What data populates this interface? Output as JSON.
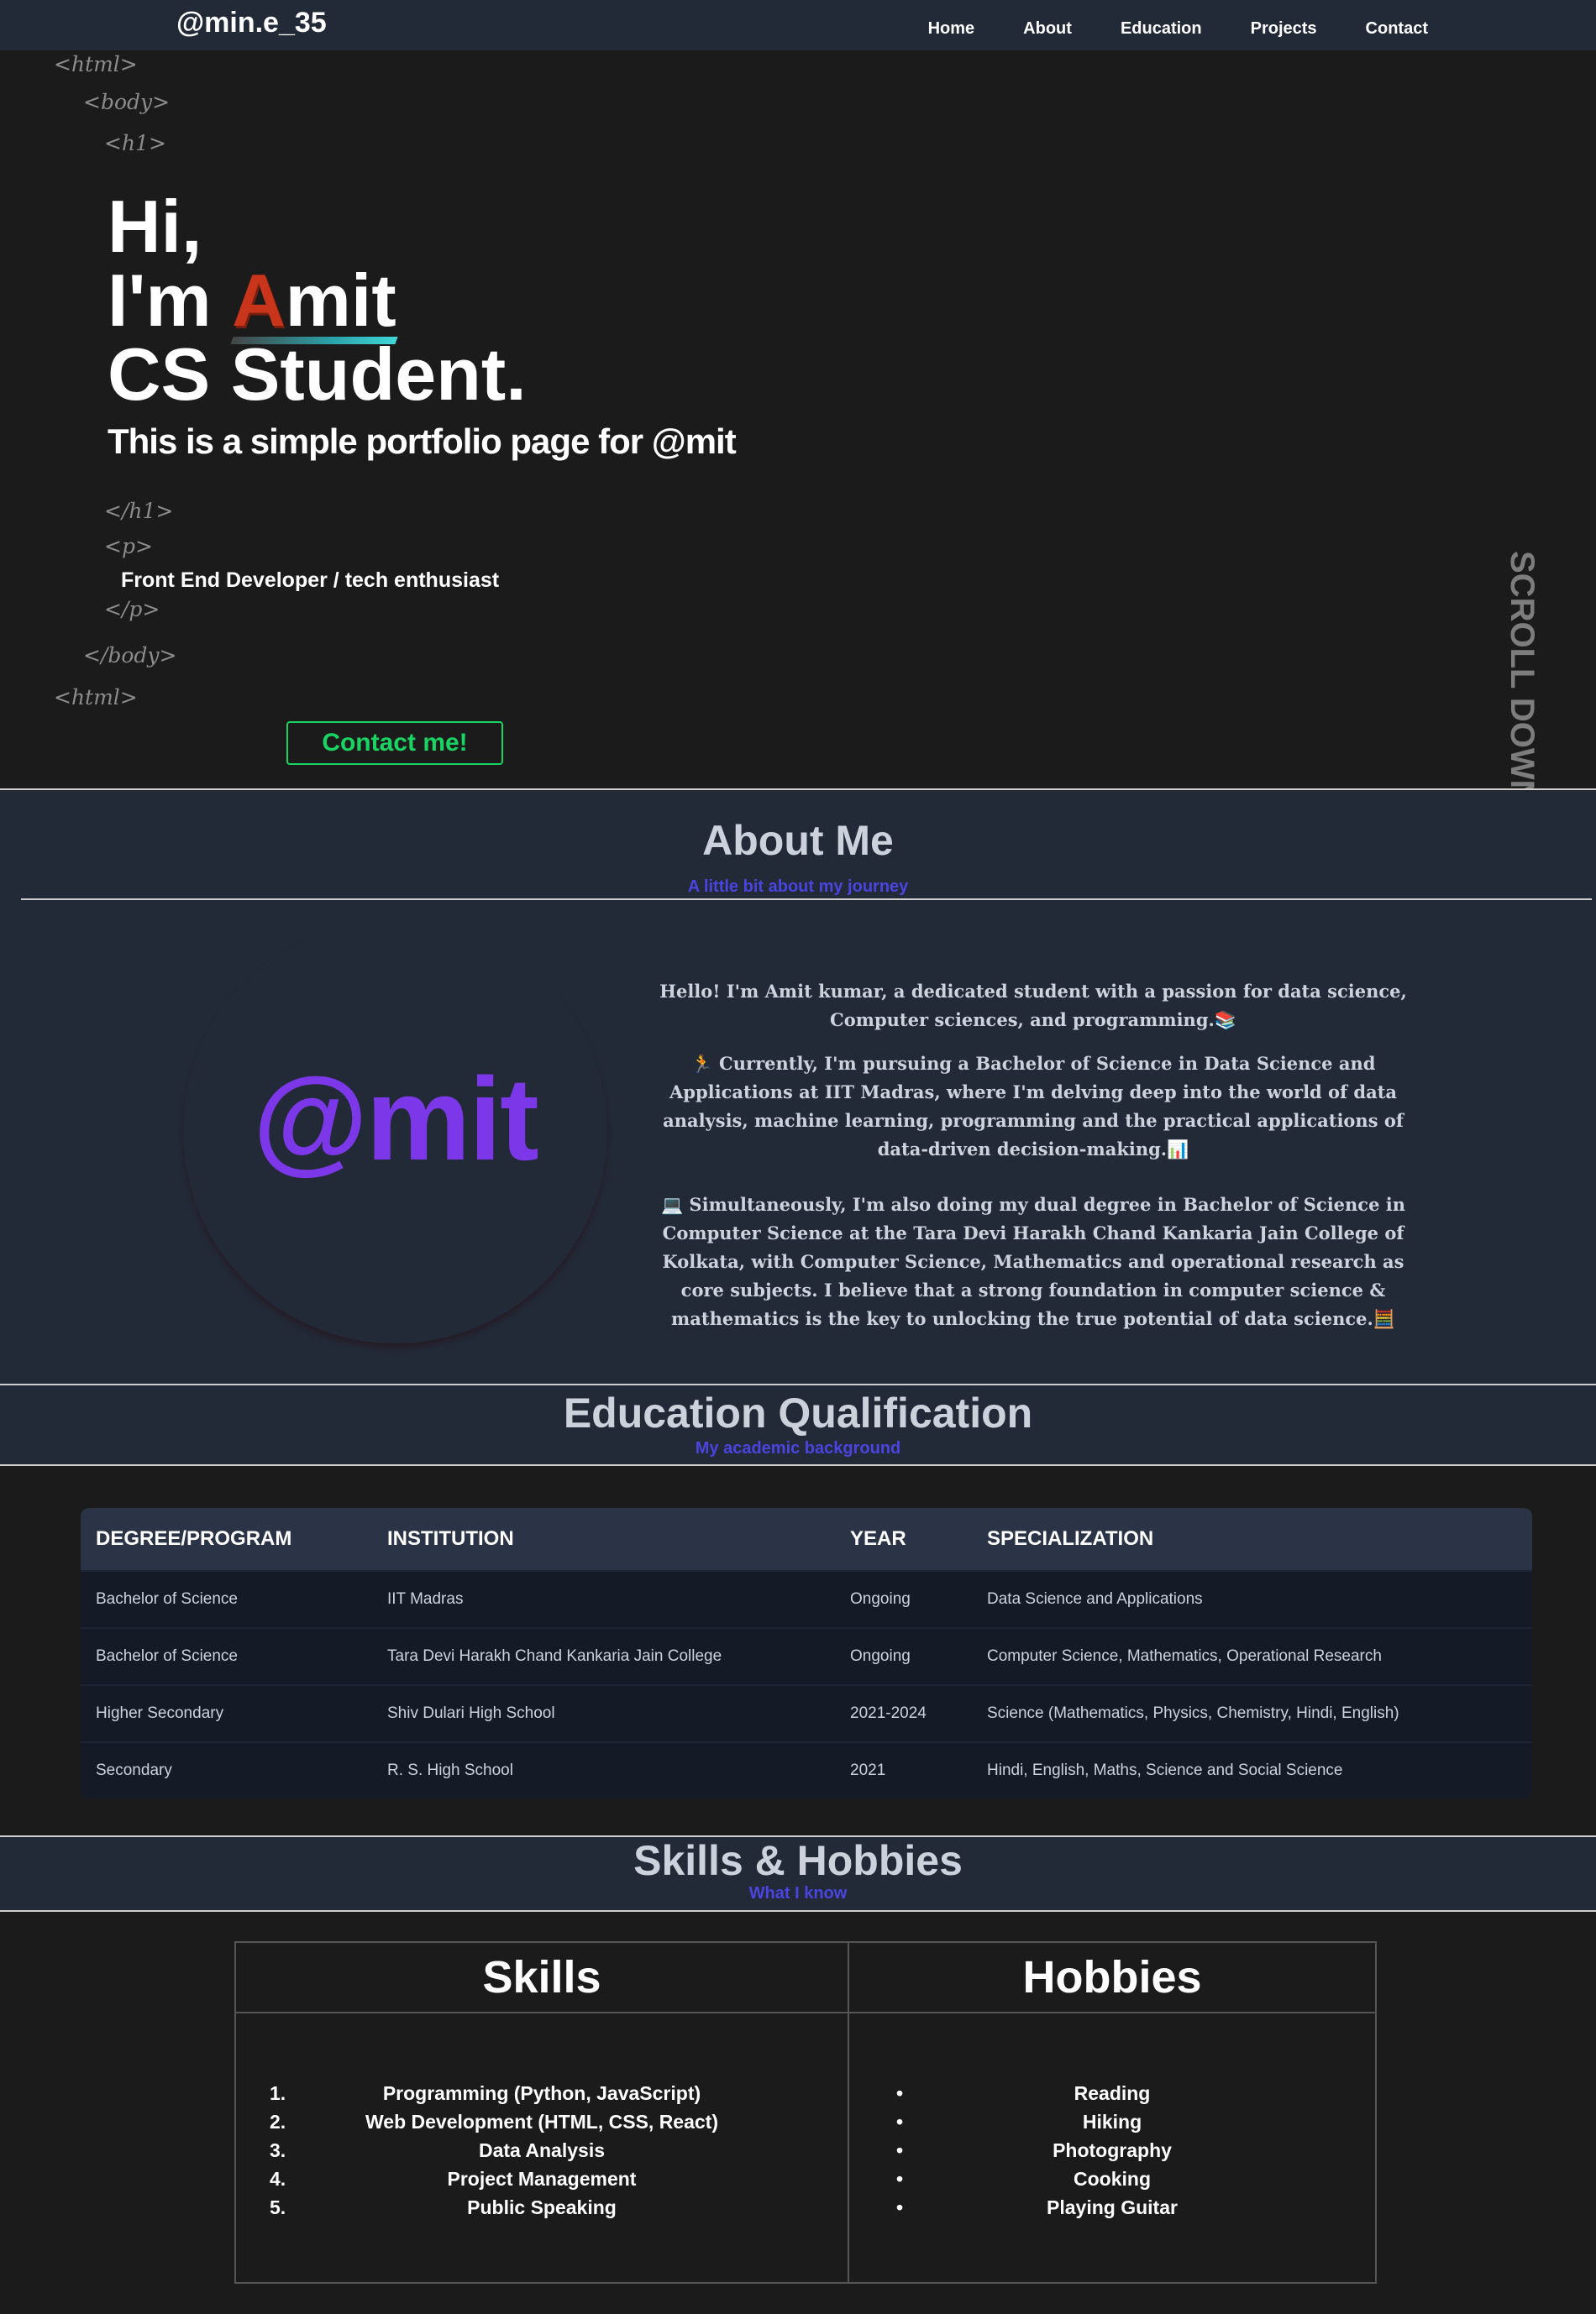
{
  "nav": {
    "logo": "@min.e_35",
    "links": [
      "Home",
      "About",
      "Education",
      "Projects",
      "Contact"
    ]
  },
  "hero": {
    "tag_html_open": "<html>",
    "tag_body_open": "<body>",
    "tag_h1_open": "<h1>",
    "line1": "Hi,",
    "line2_prefix": "I'm ",
    "line2_initial": "A",
    "line2_rest": "mit",
    "line3": "CS Student.",
    "subtitle": "This is a simple portfolio page for @mit",
    "tag_h1_close": "</h1>",
    "tag_p_open": "<p>",
    "role": "Front End Developer / tech enthusiast",
    "tag_p_close": "</p>",
    "tag_body_close": "</body>",
    "tag_html_close": "<html>",
    "contact_button": "Contact me!",
    "scroll_text": "SCROLL DOWN→"
  },
  "about": {
    "title": "About Me",
    "subtitle": "A little bit about my journey",
    "avatar_text": "@mit",
    "paragraphs": [
      "Hello! I'm Amit kumar, a dedicated student with a passion for data science, Computer sciences, and programming.📚",
      "🏃 Currently, I'm pursuing a Bachelor of Science in Data Science and Applications at IIT Madras, where I'm delving deep into the world of data analysis, machine learning, programming and the practical applications of data-driven decision-making.📊",
      "💻 Simultaneously, I'm also doing my dual degree in Bachelor of Science in Computer Science at the Tara Devi Harakh Chand Kankaria Jain College of Kolkata, with Computer Science, Mathematics and operational research as core subjects. I believe that a strong foundation in computer science & mathematics is the key to unlocking the true potential of data science.🧮"
    ]
  },
  "education": {
    "title": "Education Qualification",
    "subtitle": "My academic background",
    "headers": [
      "DEGREE/PROGRAM",
      "INSTITUTION",
      "YEAR",
      "SPECIALIZATION"
    ],
    "rows": [
      [
        "Bachelor of Science",
        "IIT Madras",
        "Ongoing",
        "Data Science and Applications"
      ],
      [
        "Bachelor of Science",
        "Tara Devi Harakh Chand Kankaria Jain College",
        "Ongoing",
        "Computer Science, Mathematics, Operational Research"
      ],
      [
        "Higher Secondary",
        "Shiv Dulari High School",
        "2021-2024",
        "Science (Mathematics, Physics, Chemistry, Hindi, English)"
      ],
      [
        "Secondary",
        "R. S. High School",
        "2021",
        "Hindi, English, Maths, Science and Social Science"
      ]
    ]
  },
  "skills_hobbies": {
    "title": "Skills & Hobbies",
    "subtitle": "What I know",
    "skills_header": "Skills",
    "hobbies_header": "Hobbies",
    "skills": [
      "Programming (Python, JavaScript)",
      "Web Development (HTML, CSS, React)",
      "Data Analysis",
      "Project Management",
      "Public Speaking"
    ],
    "hobbies": [
      "Reading",
      "Hiking",
      "Photography",
      "Cooking",
      "Playing Guitar"
    ]
  },
  "colors": {
    "nav_bg": "#222a37",
    "page_bg": "#1b1b1c",
    "accent_green": "#19d463",
    "accent_purple": "#7c38e8",
    "accent_blue": "#4b44e0"
  }
}
